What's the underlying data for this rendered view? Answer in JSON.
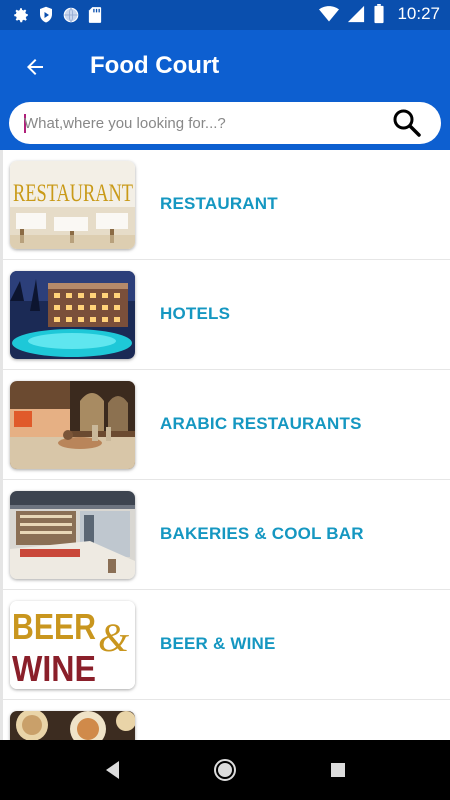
{
  "status_bar": {
    "time": "10:27",
    "left_icons": [
      "gear-icon",
      "shield-play-icon",
      "globe-icon",
      "sd-card-icon"
    ],
    "right_icons": [
      "wifi-icon",
      "signal-icon",
      "battery-icon"
    ]
  },
  "app_bar": {
    "title": "Food Court",
    "back_icon": "arrow-back-icon"
  },
  "search": {
    "placeholder": "What,where you looking for...?",
    "value": "",
    "icon": "search-icon"
  },
  "categories": [
    {
      "label": "RESTAURANT",
      "thumb_text": "RESTAURANT"
    },
    {
      "label": "HOTELS",
      "thumb_text": ""
    },
    {
      "label": "ARABIC RESTAURANTS",
      "thumb_text": ""
    },
    {
      "label": "BAKERIES & COOL BAR",
      "thumb_text": ""
    },
    {
      "label": "BEER & WINE",
      "thumb_text_1": "BEER",
      "thumb_text_2": "WINE"
    },
    {
      "label": "",
      "thumb_text": ""
    }
  ],
  "nav_bar": {
    "back": "nav-back-icon",
    "home": "nav-home-icon",
    "recents": "nav-recents-icon"
  },
  "colors": {
    "status_bar": "#0a4fae",
    "app_bar": "#0d5fd0",
    "label": "#1597c1"
  }
}
